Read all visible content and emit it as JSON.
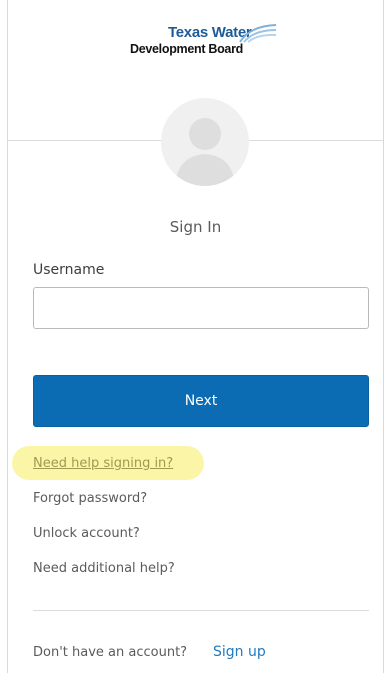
{
  "logo": {
    "line1": "Texas Water",
    "line2": "Development Board",
    "icon": "water-waves-icon"
  },
  "avatar": {
    "icon": "user-silhouette-icon"
  },
  "signin": {
    "title": "Sign In"
  },
  "username": {
    "label": "Username",
    "value": "",
    "placeholder": ""
  },
  "next_button": {
    "label": "Next"
  },
  "help": {
    "link_label": "Need help signing in?",
    "highlight_color": "#fbf6a7"
  },
  "links": {
    "forgot_password": "Forgot password?",
    "unlock_account": "Unlock account?",
    "additional_help": "Need additional help?"
  },
  "signup": {
    "prompt": "Don't have an account?",
    "link_label": "Sign up"
  },
  "colors": {
    "primary_button": "#0b6cb4",
    "link_blue": "#1f7ac2",
    "logo_blue": "#1e5c99"
  }
}
